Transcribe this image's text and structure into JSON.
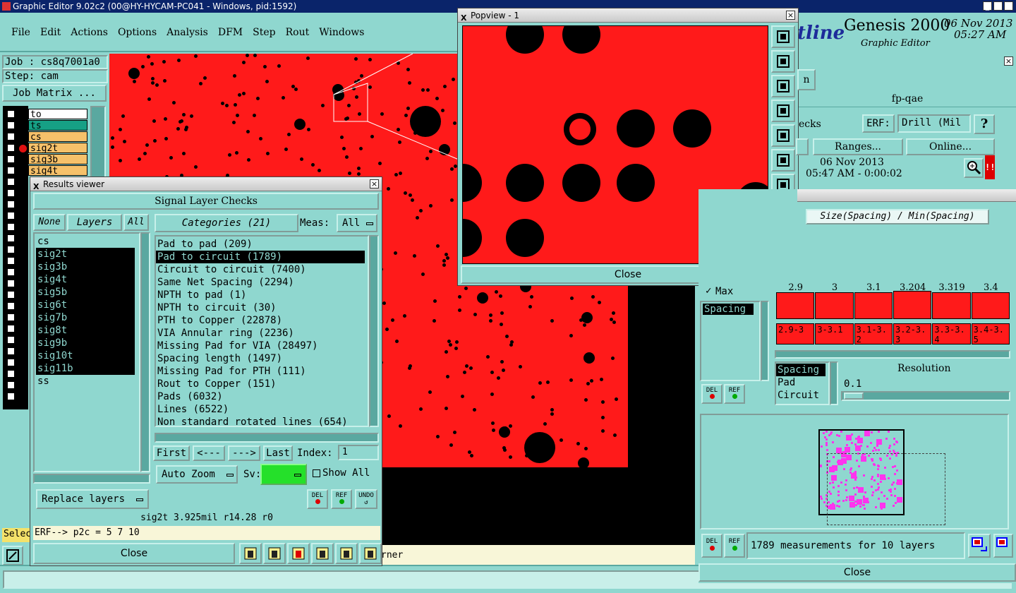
{
  "app": {
    "title": "Graphic Editor 9.02c2 (00@HY-HYCAM-PC041 - Windows, pid:1592)",
    "menu": [
      "File",
      "Edit",
      "Actions",
      "Options",
      "Analysis",
      "DFM",
      "Step",
      "Rout",
      "Windows"
    ],
    "brand": "tline",
    "product": "Genesis 2000",
    "product_sub": "Graphic Editor",
    "date": "06 Nov 2013",
    "time": "05:27 AM"
  },
  "job": {
    "job_label": "Job : cs8q7001a0",
    "step_label": "Step: cam",
    "matrix_button": "Job Matrix ...",
    "select_label": "Selec",
    "status_tail": "rner"
  },
  "layers": [
    {
      "name": "to",
      "color": "#ffffff"
    },
    {
      "name": "ts",
      "color": "#16a085"
    },
    {
      "name": "cs",
      "color": "#f6c16a"
    },
    {
      "name": "sig2t",
      "color": "#f6c16a"
    },
    {
      "name": "sig3b",
      "color": "#f6c16a"
    },
    {
      "name": "sig4t",
      "color": "#f6c16a"
    }
  ],
  "results": {
    "title": "Results viewer",
    "header": "Signal Layer Checks",
    "none": "None",
    "layers_btn": "Layers",
    "all": "All",
    "categories_btn": "Categories (21)",
    "meas_label": "Meas:",
    "meas_value": "All",
    "layer_list": [
      "cs",
      "sig2t",
      "sig3b",
      "sig4t",
      "sig5b",
      "sig6t",
      "sig7b",
      "sig8t",
      "sig9b",
      "sig10t",
      "sig11b",
      "ss"
    ],
    "categories": [
      "Pad to pad (209)",
      "Pad to circuit (1789)",
      "Circuit to circuit (7400)",
      "Same Net Spacing (2294)",
      "NPTH to pad (1)",
      "NPTH to circuit (30)",
      "PTH to Copper (22878)",
      "VIA Annular ring (2236)",
      "Missing Pad for VIA (28497)",
      "Spacing length (1497)",
      "Missing Pad for PTH (111)",
      "Rout to Copper (151)",
      "Pads (6032)",
      "Lines (6522)",
      "Non standard rotated lines (654)"
    ],
    "first": "First",
    "prev": "<---",
    "next": "--->",
    "last": "Last",
    "index_label": "Index:",
    "index_value": "1",
    "auto_zoom": "Auto Zoom",
    "sv_label": "Sv:",
    "show_all": "Show All",
    "replace_layers": "Replace layers",
    "del": "DEL",
    "ref": "REF",
    "undo": "UNDO",
    "status": "sig2t 3.925mil  r14.28  r0",
    "erf": "ERF--> p2c = 5 7 10",
    "close": "Close"
  },
  "popview": {
    "title": "Popview - 1",
    "close": "Close"
  },
  "right": {
    "btn_n": "n",
    "fp": "fp-qae",
    "checks": "ecks",
    "erf_label": "ERF:",
    "erf_value": "Drill (Mil",
    "help": "?",
    "ranges": "Ranges...",
    "online": "Online...",
    "date": "06 Nov 2013",
    "time": "05:47 AM - 0:00:02",
    "stat_title": "Size(Spacing) / Min(Spacing)",
    "max_label": "Max",
    "spacing_item": "Spacing",
    "bar_values": [
      "2.9",
      "3",
      "3.1",
      "3.204",
      "3.319",
      "3.4"
    ],
    "bar_ranges": [
      "2.9-3",
      "3-3.1",
      "3.1-3.2",
      "3.2-3.3",
      "3.3-3.4",
      "3.4-3.5"
    ],
    "type_list": [
      "Spacing",
      "Pad",
      "Circuit"
    ],
    "resolution_label": "Resolution",
    "resolution_value": "0.1",
    "measurements": "1789 measurements for 10 layers",
    "close": "Close",
    "del": "DEL",
    "ref": "REF"
  }
}
